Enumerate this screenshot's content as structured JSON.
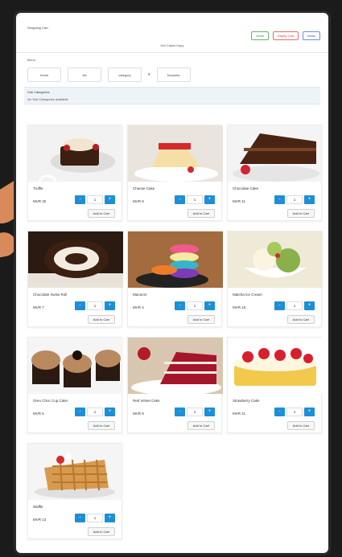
{
  "app": {
    "title": "Shopping Cart",
    "subtitle": "Hot Cakes Kopy"
  },
  "top_buttons": [
    {
      "label": "Order",
      "color": "#2f8a2f"
    },
    {
      "label": "Empty Cart",
      "color": "#dd3333"
    },
    {
      "label": "Items",
      "color": "#2b4fa8"
    }
  ],
  "menu": {
    "label": "Menu",
    "items": [
      "Home",
      "Art",
      "category",
      "Desserts"
    ],
    "dropdown_icon": "chevron-down-icon"
  },
  "subcategories": {
    "title": "Sub Categories",
    "note": "No Sub Categories available"
  },
  "products": [
    {
      "name": "Truffle",
      "price": "MVR 25",
      "qty": "1",
      "add_label": "Add to Cart",
      "image": "chocolate-dessert-image"
    },
    {
      "name": "Cheese Cake",
      "price": "MVR 9",
      "qty": "1",
      "add_label": "Add to Cart",
      "image": "cheesecake-image"
    },
    {
      "name": "Chocolate Cake",
      "price": "MVR 11",
      "qty": "1",
      "add_label": "Add to Cart",
      "image": "chocolate-cake-image"
    },
    {
      "name": "Chocolate Swiss Roll",
      "price": "MVR 7",
      "qty": "1",
      "add_label": "Add to Cart",
      "image": "swiss-roll-image"
    },
    {
      "name": "Macaron",
      "price": "MVR 4",
      "qty": "1",
      "add_label": "Add to Cart",
      "image": "macaron-image"
    },
    {
      "name": "Matcha Ice Cream",
      "price": "MVR 16",
      "qty": "1",
      "add_label": "Add to Cart",
      "image": "matcha-icecream-image"
    },
    {
      "name": "Oreo Choc Cup Cake",
      "price": "MVR 6",
      "qty": "1",
      "add_label": "Add to Cart",
      "image": "cupcake-image"
    },
    {
      "name": "Red Velvet Cake",
      "price": "MVR 9",
      "qty": "1",
      "add_label": "Add to Cart",
      "image": "red-velvet-image"
    },
    {
      "name": "Strawberry Cake",
      "price": "MVR 11",
      "qty": "1",
      "add_label": "Add to Cart",
      "image": "strawberry-cake-image"
    },
    {
      "name": "Waffle",
      "price": "MVR 13",
      "qty": "1",
      "add_label": "Add to Cart",
      "image": "waffle-image"
    }
  ],
  "stepper_labels": {
    "minus": "-",
    "plus": "+"
  }
}
